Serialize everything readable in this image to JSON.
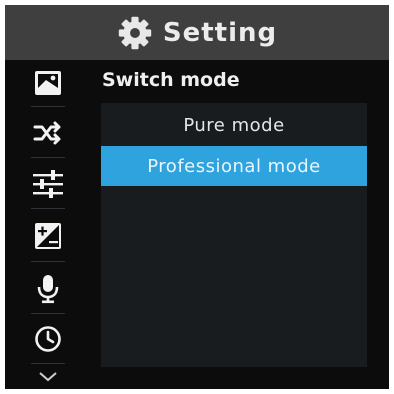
{
  "header": {
    "title": "Setting",
    "icon": "gear-icon"
  },
  "sidebar": {
    "items": [
      {
        "icon": "image-icon"
      },
      {
        "icon": "shuffle-icon"
      },
      {
        "icon": "sliders-icon"
      },
      {
        "icon": "exposure-icon"
      },
      {
        "icon": "microphone-icon"
      },
      {
        "icon": "clock-icon"
      },
      {
        "icon": "chevron-down-icon"
      }
    ]
  },
  "main": {
    "section_label": "Switch mode",
    "options": [
      {
        "label": "Pure mode",
        "selected": false
      },
      {
        "label": "Professional mode",
        "selected": true
      }
    ]
  },
  "colors": {
    "header_bg": "#3f3f3f",
    "screen_bg": "#0c0c0c",
    "panel_bg": "#181c1f",
    "accent": "#2ea3dd"
  }
}
